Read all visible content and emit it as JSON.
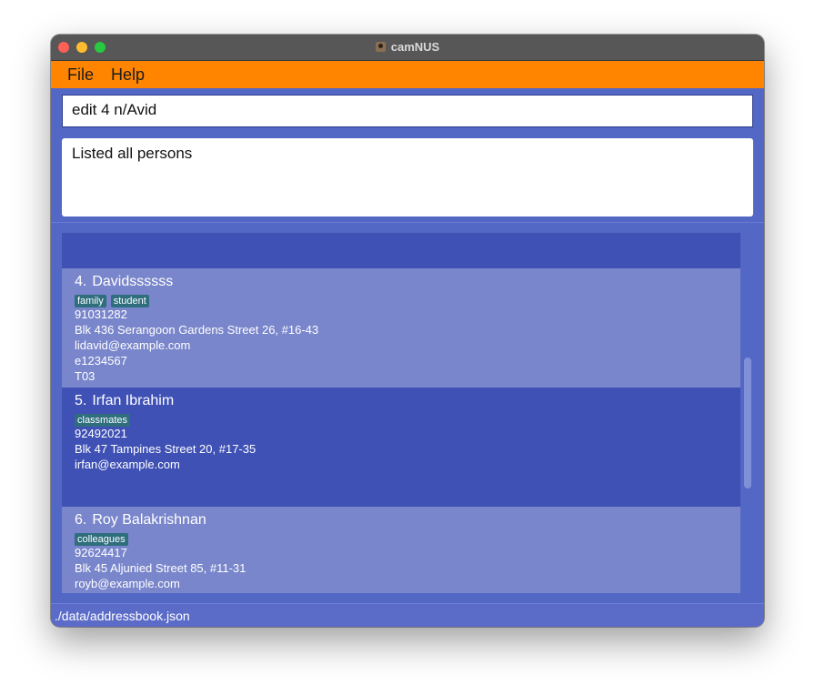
{
  "window": {
    "title": "camNUS"
  },
  "menu": {
    "file": "File",
    "help": "Help"
  },
  "command": {
    "value": "edit 4 n/Avid"
  },
  "result": {
    "text": "Listed all persons"
  },
  "persons": [
    {
      "index": "4.",
      "name": "Davidssssss",
      "tags": [
        "family",
        "student"
      ],
      "phone": "91031282",
      "address": "Blk 436 Serangoon Gardens Street 26, #16-43",
      "email": "lidavid@example.com",
      "student_id": "e1234567",
      "tutorial": "T03"
    },
    {
      "index": "5.",
      "name": "Irfan Ibrahim",
      "tags": [
        "classmates"
      ],
      "phone": "92492021",
      "address": "Blk 47 Tampines Street 20, #17-35",
      "email": "irfan@example.com"
    },
    {
      "index": "6.",
      "name": "Roy Balakrishnan",
      "tags": [
        "colleagues"
      ],
      "phone": "92624417",
      "address": "Blk 45 Aljunied Street 85, #11-31",
      "email": "royb@example.com"
    }
  ],
  "status": {
    "path": "./data/addressbook.json"
  },
  "icons": {
    "app": "address-book-icon"
  },
  "colors": {
    "menubar": "#ff8400",
    "card_light": "#7986cb",
    "card_dark": "#3f51b5",
    "tag": "#2e6e7d"
  }
}
